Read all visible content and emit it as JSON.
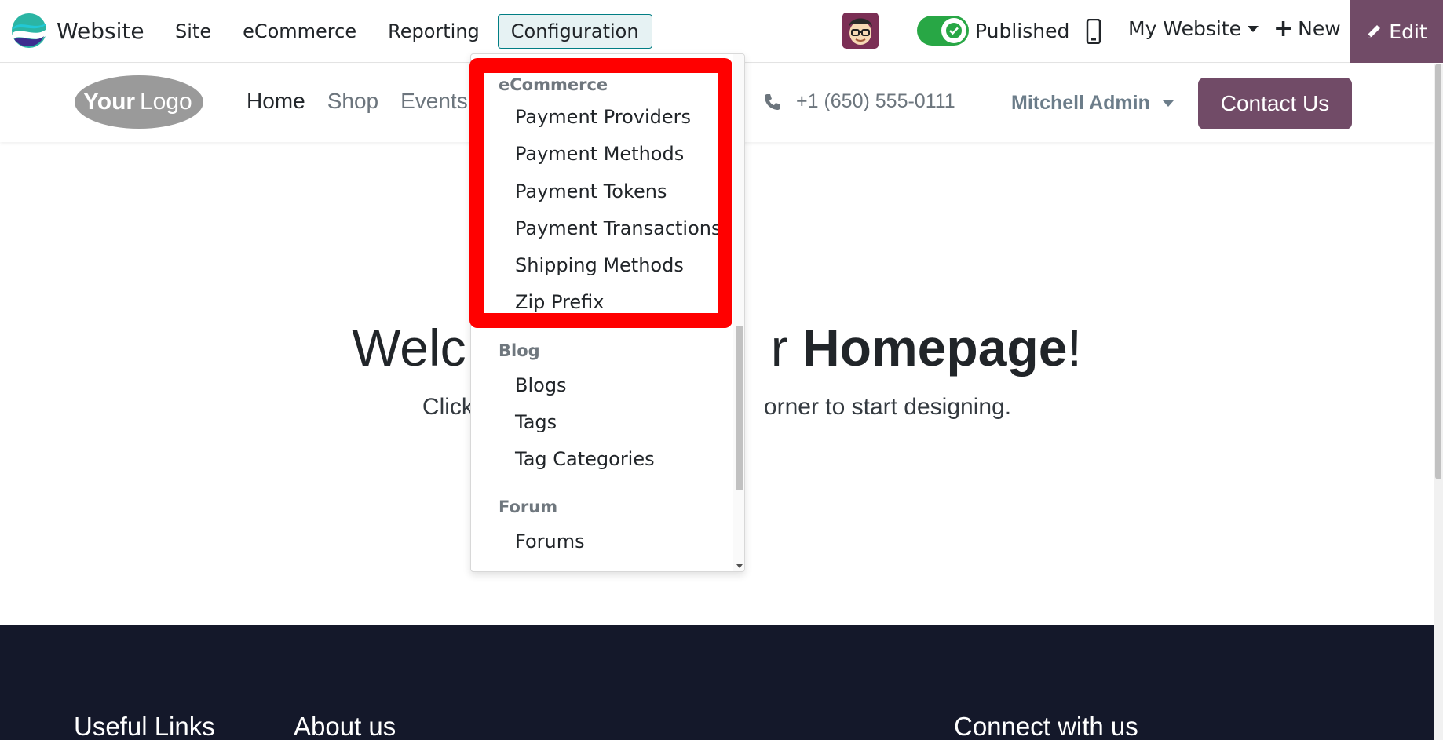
{
  "topbar": {
    "app_name": "Website",
    "menu": [
      "Site",
      "eCommerce",
      "Reporting",
      "Configuration"
    ],
    "active_menu": "Configuration",
    "published_label": "Published",
    "website_selector": "My Website",
    "new_label": "New",
    "edit_label": "Edit"
  },
  "site_header": {
    "logo_text": "YourLogo",
    "nav": [
      "Home",
      "Shop",
      "Events"
    ],
    "phone": "+1 (650) 555-0111",
    "user": "Mitchell Admin",
    "contact_label": "Contact Us"
  },
  "hero": {
    "title_prefix": "Welc",
    "title_mid": "r ",
    "title_bold": "Homepage",
    "title_suffix": "!",
    "subtitle_start": "Click",
    "subtitle_end": "orner to start designing."
  },
  "footer": {
    "col1": "Useful Links",
    "col2": "About us",
    "col3": "Connect with us"
  },
  "dropdown": {
    "sections": [
      {
        "header": "eCommerce",
        "items": [
          "Payment Providers",
          "Payment Methods",
          "Payment Tokens",
          "Payment Transactions",
          "Shipping Methods",
          "Zip Prefix"
        ]
      },
      {
        "header": "Blog",
        "items": [
          "Blogs",
          "Tags",
          "Tag Categories"
        ]
      },
      {
        "header": "Forum",
        "items": [
          "Forums"
        ]
      }
    ]
  },
  "colors": {
    "brand_purple": "#714b67",
    "active_teal": "#017e84",
    "toggle_green": "#28a745",
    "highlight_red": "#ff0000",
    "footer_bg": "#14182a"
  }
}
